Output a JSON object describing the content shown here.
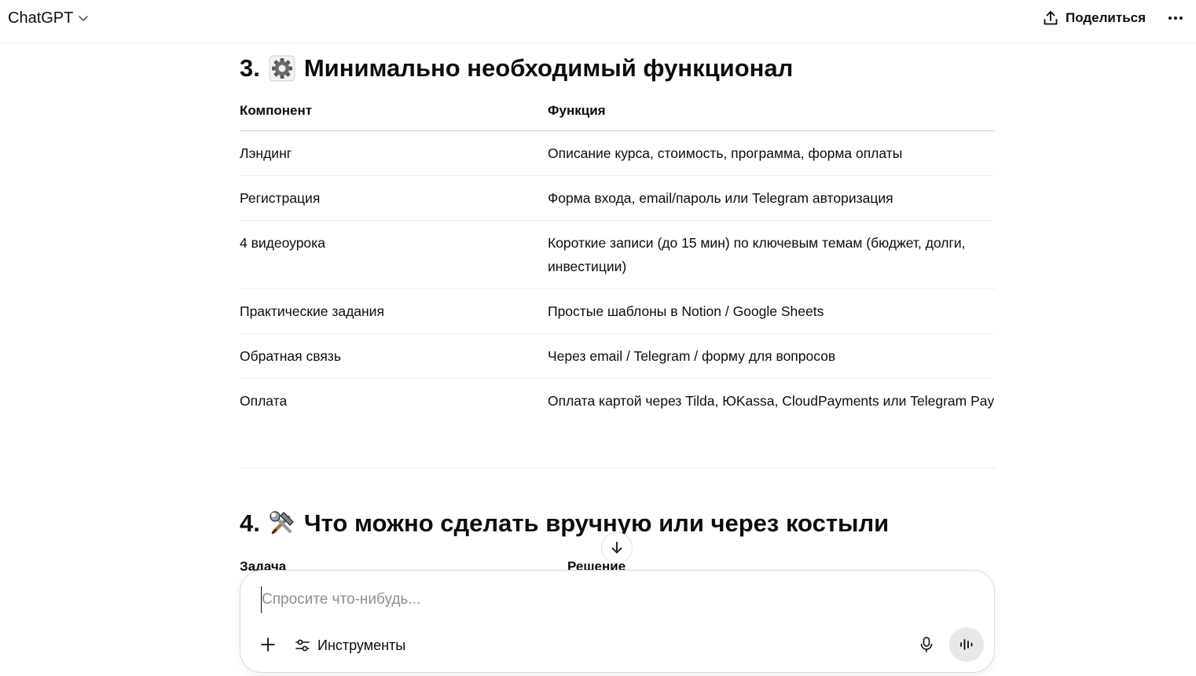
{
  "header": {
    "app_title": "ChatGPT",
    "share_label": "Поделиться"
  },
  "section3": {
    "number": "3.",
    "emoji": "gear-emoji",
    "title": "Минимально необходимый функционал",
    "table": {
      "headers": [
        "Компонент",
        "Функция"
      ],
      "rows": [
        [
          "Лэндинг",
          "Описание курса, стоимость, программа, форма оплаты"
        ],
        [
          "Регистрация",
          "Форма входа, email/пароль или Telegram авторизация"
        ],
        [
          "4 видеоурока",
          "Короткие записи (до 15 мин) по ключевым темам (бюджет, долги, инвестиции)"
        ],
        [
          "Практические задания",
          "Простые шаблоны в Notion / Google Sheets"
        ],
        [
          "Обратная связь",
          "Через email / Telegram / форму для вопросов"
        ],
        [
          "Оплата",
          "Оплата картой через Tilda, ЮKassa, CloudPayments или Telegram Pay"
        ]
      ]
    }
  },
  "section4": {
    "number": "4.",
    "emoji": "hammer-and-wrench-emoji",
    "title": "Что можно сделать вручную или через костыли",
    "table": {
      "headers": [
        "Задача",
        "Решение"
      ]
    }
  },
  "composer": {
    "placeholder": "Спросите что-нибудь...",
    "tools_label": "Инструменты"
  },
  "colors": {
    "text": "#0d0d0d",
    "placeholder": "#8f8f8f",
    "voice_button_bg": "#e8e8e8"
  }
}
